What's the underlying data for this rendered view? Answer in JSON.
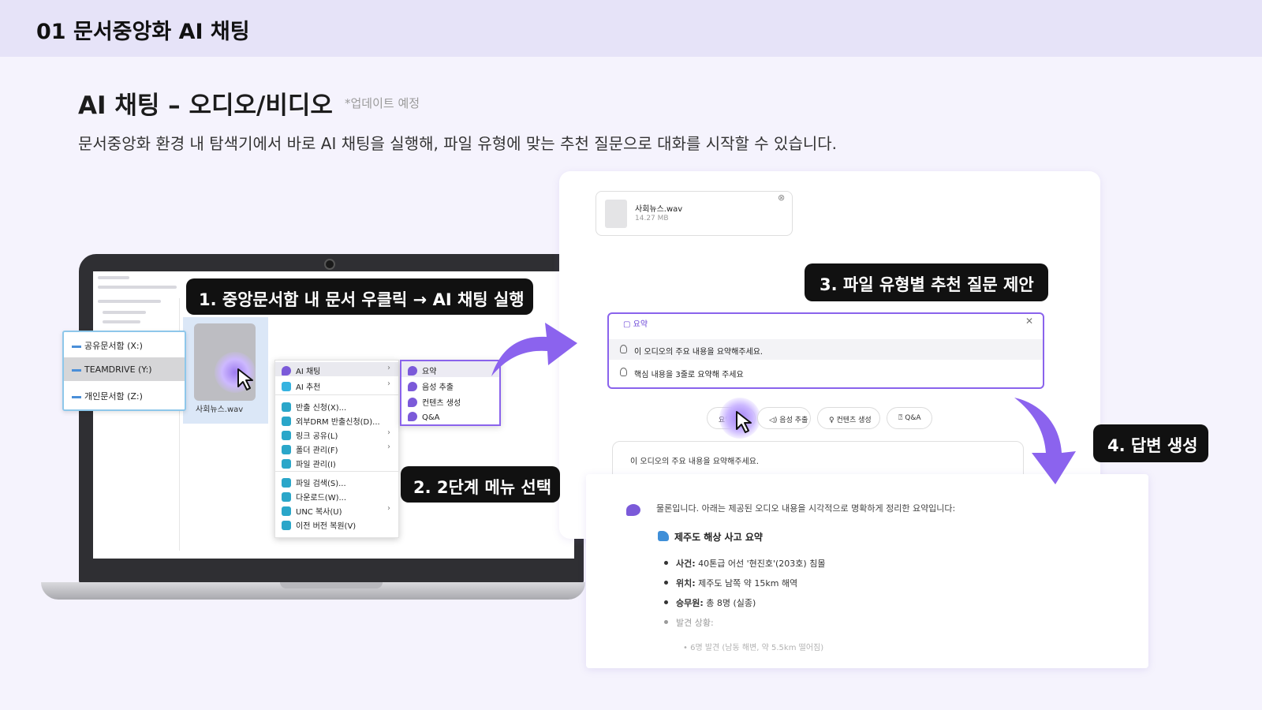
{
  "header": {
    "title": "01  문서중앙화 AI 채팅"
  },
  "section": {
    "title": "AI 채팅 – 오디오/비디오",
    "note": "*업데이트 예정",
    "description": "문서중앙화 환경 내 탐색기에서 바로 AI 채팅을 실행해, 파일 유형에 맞는 추천 질문으로 대화를 시작할 수 있습니다."
  },
  "steps": {
    "step1": "1. 중앙문서함 내 문서 우클릭 → AI 채팅 실행",
    "step2": "2. 2단계 메뉴 선택",
    "step3": "3. 파일 유형별 추천 질문 제안",
    "step4": "4. 답변 생성"
  },
  "drives": [
    {
      "label": "공유문서함 (X:)"
    },
    {
      "label": "TEAMDRIVE (Y:)"
    },
    {
      "label": "개인문서함 (Z:)"
    }
  ],
  "explorer": {
    "file_name": "사회뉴스.wav"
  },
  "context_menu": {
    "items": [
      {
        "label": "AI 채팅"
      },
      {
        "label": "AI 추천"
      },
      {
        "label": "반출 신청(X)..."
      },
      {
        "label": "외부DRM 반출신청(D)..."
      },
      {
        "label": "링크 공유(L)"
      },
      {
        "label": "폴더 관리(F)"
      },
      {
        "label": "파일 관리(I)"
      },
      {
        "label": "파일 검색(S)..."
      },
      {
        "label": "다운로드(W)..."
      },
      {
        "label": "UNC 복사(U)"
      },
      {
        "label": "이전 버전 복원(V)"
      }
    ],
    "submenu": [
      {
        "label": "요약"
      },
      {
        "label": "음성 추출"
      },
      {
        "label": "컨텐츠 생성"
      },
      {
        "label": "Q&A"
      }
    ]
  },
  "chat": {
    "attachment": {
      "name": "사회뉴스.wav",
      "size": "14.27 MB"
    },
    "suggest_header": "요약",
    "suggestions": [
      {
        "text": "이 오디오의 주요 내용을 요약해주세요."
      },
      {
        "text": "핵심 내용을 3줄로 요약해 주세요"
      }
    ],
    "chips": [
      {
        "label": "요약"
      },
      {
        "label": "음성 추출"
      },
      {
        "label": "컨텐츠 생성"
      },
      {
        "label": "Q&A"
      }
    ],
    "query": "이 오디오의 주요 내용을 요약해주세요."
  },
  "answer": {
    "intro": "물론입니다. 아래는 제공된 오디오 내용을 시각적으로 명확하게 정리한 요약입니다:",
    "title": "제주도 해상 사고 요약",
    "bullets": [
      {
        "key": "사건:",
        "value": " 40톤급 어선 '현진호'(203호) 침몰"
      },
      {
        "key": "위치:",
        "value": " 제주도 남쪽 약 15km 해역"
      },
      {
        "key": "승무원:",
        "value": " 총 8명 (실종)"
      },
      {
        "key": "",
        "value": "발견 상황:"
      }
    ],
    "sub_bullet": "6명 발견 (남동 해변, 약 5.5km 떨어짐)"
  },
  "colors": {
    "accent": "#8a63ec",
    "step_bg": "#111111",
    "header_bg": "#e6e3f8"
  }
}
